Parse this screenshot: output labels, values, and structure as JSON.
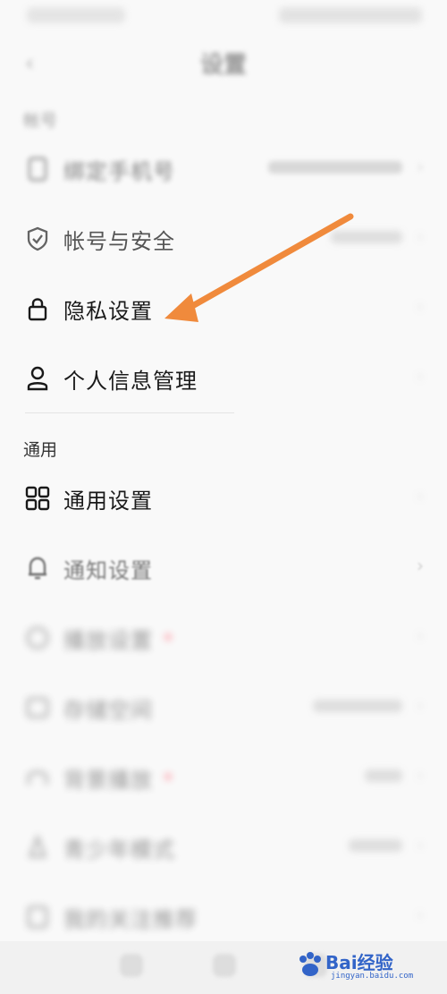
{
  "nav": {
    "title": "设置"
  },
  "sections": {
    "account": {
      "title": "帐号"
    },
    "general": {
      "title": "通用"
    }
  },
  "account_items": [
    {
      "label": "绑定手机号"
    },
    {
      "label": "帐号与安全"
    },
    {
      "label": "隐私设置"
    },
    {
      "label": "个人信息管理"
    }
  ],
  "general_items": [
    {
      "label": "通用设置"
    },
    {
      "label": "通知设置"
    },
    {
      "label": "播放设置"
    },
    {
      "label": "存储空间"
    },
    {
      "label": "背景播放"
    },
    {
      "label": "青少年模式"
    },
    {
      "label": "我的关注推荐"
    }
  ],
  "watermark": {
    "brand": "Bai经验",
    "url": "jingyan.baidu.com"
  },
  "colors": {
    "arrow": "#f08a3c",
    "background": "#f9f9f9"
  }
}
